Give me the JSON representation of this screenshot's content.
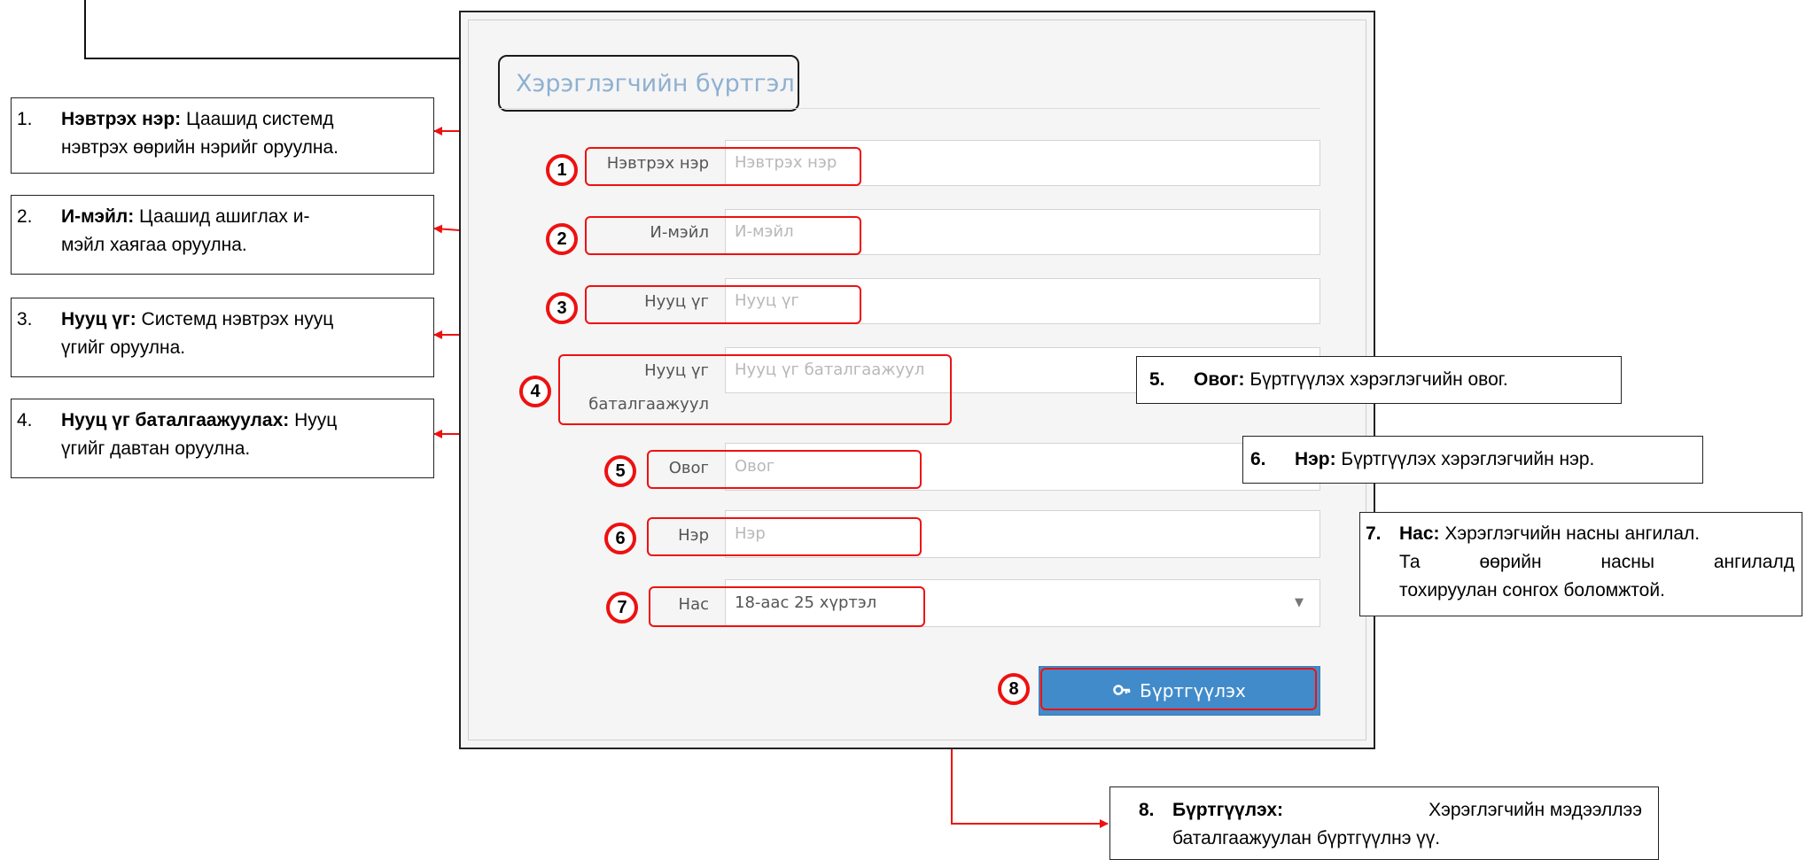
{
  "form": {
    "title": "Хэрэглэгчийн бүртгэл",
    "fields": [
      {
        "num": "1",
        "label": "Нэвтрэх нэр",
        "placeholder": "Нэвтрэх нэр"
      },
      {
        "num": "2",
        "label": "И-мэйл",
        "placeholder": "И-мэйл"
      },
      {
        "num": "3",
        "label": "Нууц үг",
        "placeholder": "Нууц үг"
      },
      {
        "num": "4",
        "label_line1": "Нууц үг",
        "label_line2": "баталгаажуул",
        "placeholder": "Нууц үг баталгаажуул"
      },
      {
        "num": "5",
        "label": "Овог",
        "placeholder": "Овог"
      },
      {
        "num": "6",
        "label": "Нэр",
        "placeholder": "Нэр"
      },
      {
        "num": "7",
        "label": "Нас",
        "value": "18-аас 25 хүртэл"
      }
    ],
    "submit": {
      "num": "8",
      "label": "Бүртгүүлэх",
      "icon": "key-icon"
    }
  },
  "callouts": [
    {
      "num": "1.",
      "term": "Нэвтрэх нэр:",
      "text1": " Цаашид системд",
      "text2": "нэвтрэх өөрийн нэрийг оруулна."
    },
    {
      "num": "2.",
      "term": "И-мэйл:",
      "text1": " Цаашид ашиглах и-",
      "text2": "мэйл хаягаа оруулна."
    },
    {
      "num": "3.",
      "term": "Нууц үг:",
      "text1": " Системд нэвтрэх нууц",
      "text2": "үгийг оруулна."
    },
    {
      "num": "4.",
      "term": "Нууц үг баталгаажуулах:",
      "text1": " Нууц",
      "text2": "үгийг давтан оруулна."
    },
    {
      "num": "5.",
      "term": "Овог:",
      "text1": " Бүртгүүлэх хэрэглэгчийн овог."
    },
    {
      "num": "6.",
      "term": "Нэр:",
      "text1": " Бүртгүүлэх хэрэглэгчийн нэр."
    },
    {
      "num": "7.",
      "term": "Нас:",
      "text1": " Хэрэглэгчийн насны ангилал.",
      "text2": "Та өөрийн насны ангилалд",
      "text3": "тохируулан сонгох боломжтой."
    },
    {
      "num": "8.",
      "term": "Бүртгүүлэх:",
      "text1": " Хэрэглэгчийн мэдээллээ",
      "text2": "баталгаажуулан бүртгүүлнэ үү."
    }
  ],
  "colors": {
    "annotation": "#ee1111",
    "button": "#428bca",
    "title": "#8fb0d1"
  }
}
